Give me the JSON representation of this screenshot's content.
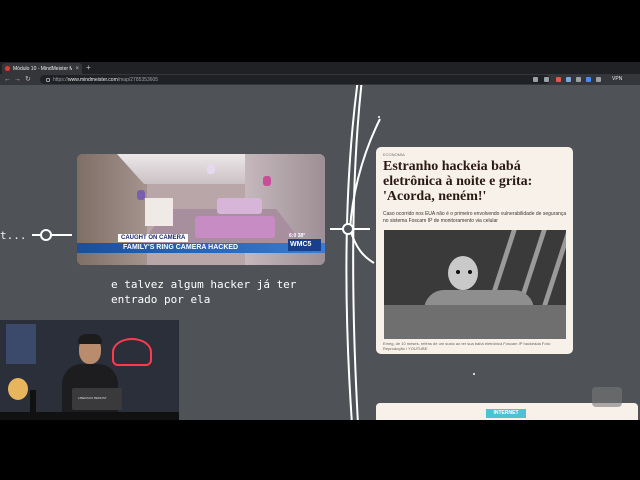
{
  "browser": {
    "tab": {
      "title": "Módulo 10 - MindMeister Mind",
      "close_icon": "close-icon"
    },
    "new_tab": "+",
    "url_prefix": "https://",
    "url_host": "www.mindmeister.com",
    "url_path": "/map/2785353605",
    "vpn": "VPN"
  },
  "canvas": {
    "left_fragment": "t...",
    "video": {
      "caught": "CAUGHT ON CAMERA",
      "headline": "FAMILY'S RING CAMERA HACKED",
      "time": "6:0 ",
      "temp": "38°",
      "station": "WMC5"
    },
    "caption": "e talvez algum hacker já ter entrado por ela",
    "article": {
      "tag": "ECONOMIA",
      "title": "Estranho hackeia babá eletrônica à noite e grita: 'Acorda, neném!'",
      "lede": "Caso ocorrido nos EUA não é o primeiro envolvendo vulnerabilidade de segurança no sistema Foscam IP de monitoramento via celular",
      "credit": "Emeg, de 10 meses, reféns de um susto ao ter sua babá eletrônica Foscam IP hackeada Foto: Reprodução / YOUTUBE"
    },
    "article2": {
      "chip": "INTERNET"
    }
  },
  "webcam": {
    "laptop_label": "LIBERADO BEMOST"
  },
  "colors": {
    "canvas": "#4f5357",
    "card": "#f7f1ea",
    "accent": "#4cc3d1",
    "neon": "#ff3b4a"
  }
}
